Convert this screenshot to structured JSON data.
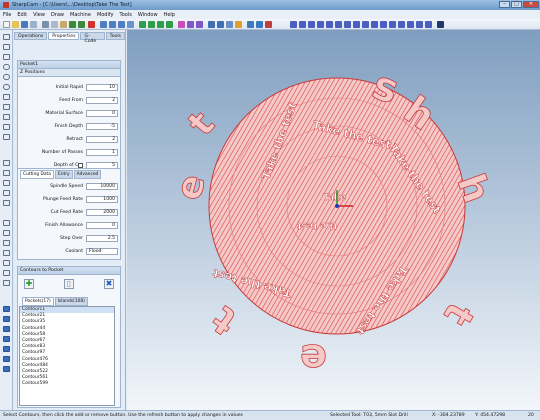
{
  "window": {
    "title": "SharpCam - [C:\\Users\\...\\Desktop\\Take The Test]"
  },
  "menu": [
    "File",
    "Edit",
    "View",
    "Draw",
    "Machine",
    "Modify",
    "Tools",
    "Window",
    "Help"
  ],
  "panel": {
    "tabs": [
      "Operations",
      "Properties",
      "G-Code",
      "Tools"
    ],
    "active_tab": "Properties",
    "operation_name": "Pocket1",
    "zpos_header": "Z Positions",
    "z": [
      {
        "label": "Initial Rapid",
        "value": "10"
      },
      {
        "label": "Feed From",
        "value": "2"
      },
      {
        "label": "Material Surface",
        "value": "0"
      },
      {
        "label": "Finish Depth",
        "value": "-5"
      },
      {
        "label": "Retract",
        "value": "2"
      },
      {
        "label": "Number of Passes",
        "value": "1"
      },
      {
        "label": "Depth of Cut",
        "value": "5"
      }
    ],
    "subtabs": [
      "Cutting Data",
      "Entry",
      "Advanced"
    ],
    "cut": [
      {
        "label": "Spindle Speed",
        "value": "10000"
      },
      {
        "label": "Plunge Feed Rate",
        "value": "1000"
      },
      {
        "label": "Cut Feed Rate",
        "value": "2000"
      },
      {
        "label": "Finish Allowance",
        "value": "0"
      },
      {
        "label": "Step Over",
        "value": "2.5"
      },
      {
        "label": "Coolant",
        "value": "Flood"
      }
    ],
    "contours_header": "Contours to Pocket",
    "contour_tabs": [
      "Pockets(17)",
      "Islands(108)"
    ],
    "contours": [
      "Contour11",
      "Contour21",
      "Contour35",
      "Contour44",
      "Contour58",
      "Contour67",
      "Contour83",
      "Contour97",
      "Contour476",
      "Contour484",
      "Contour522",
      "Contour561",
      "Contour599"
    ]
  },
  "canvas": {
    "text_fill": "#f3b8b8",
    "stroke": "#d94545",
    "words": [
      "t",
      "h",
      "e",
      "t",
      "e",
      "s",
      "t"
    ]
  },
  "status": {
    "hint": "Select Contours, then click the add or remove button. Use the refresh button to apply changes in values",
    "tool": "Selected Tool: T03, 5mm Slot Drill",
    "x": "X: -304.23789",
    "y": "Y: 454.47298",
    "z": "20"
  }
}
